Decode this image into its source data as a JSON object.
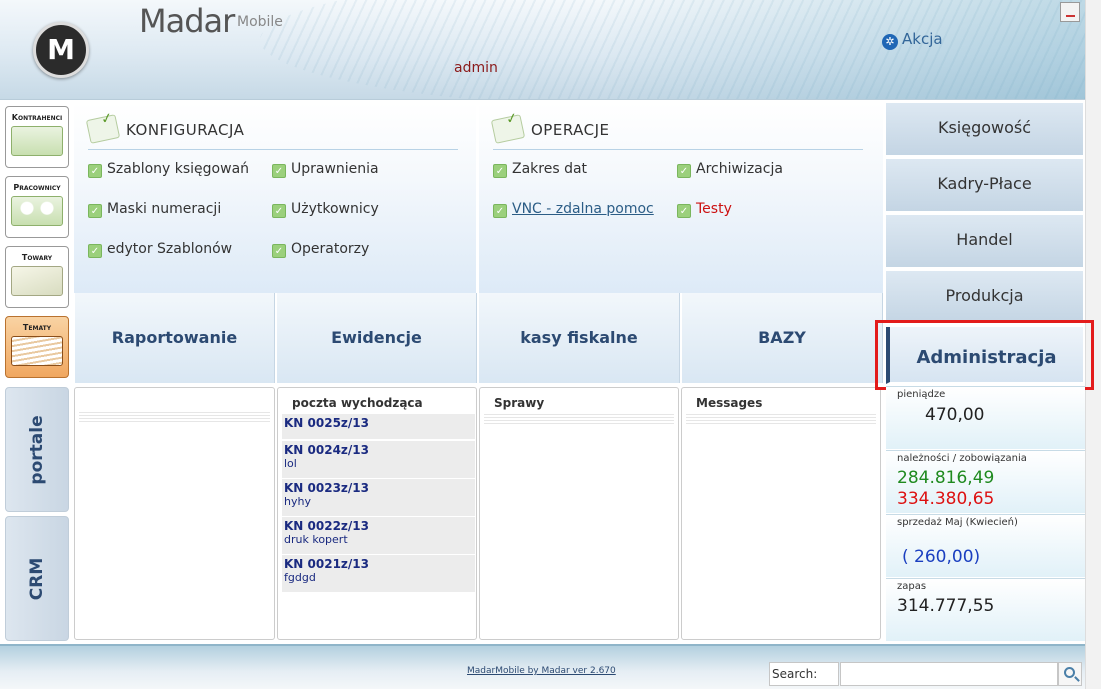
{
  "header": {
    "brand": "Madar",
    "brand_sub": "Mobile",
    "logo_letter": "M",
    "user": "admin",
    "akcja": "Akcja"
  },
  "left_nav": [
    {
      "label": "Kontrahenci",
      "icon": "buildings-icon"
    },
    {
      "label": "Pracownicy",
      "icon": "people-icon"
    },
    {
      "label": "Towary",
      "icon": "box-icon"
    },
    {
      "label": "Tematy",
      "icon": "documents-icon"
    }
  ],
  "vertical_tabs": [
    "portale",
    "CRM"
  ],
  "konfiguracja": {
    "title": "KONFIGURACJA",
    "items": [
      "Szablony księgowań",
      "Uprawnienia",
      "Maski numeracji",
      "Użytkownicy",
      "edytor Szablonów",
      "Operatorzy"
    ]
  },
  "operacje": {
    "title": "OPERACJE",
    "items": [
      "Zakres dat",
      "Archiwizacja",
      "VNC - zdalna pomoc",
      "Testy"
    ]
  },
  "tabs": [
    "Raportowanie",
    "Ewidencje",
    "kasy fiskalne",
    "BAZY"
  ],
  "columns": {
    "c2_title": "poczta wychodząca",
    "c3_title": "Sprawy",
    "c4_title": "Messages",
    "documents": [
      {
        "number": "KN 0025z/13",
        "desc": ""
      },
      {
        "number": "KN 0024z/13",
        "desc": "lol"
      },
      {
        "number": "KN 0023z/13",
        "desc": "hyhy"
      },
      {
        "number": "KN 0022z/13",
        "desc": "druk kopert"
      },
      {
        "number": "KN 0021z/13",
        "desc": "fgdgd"
      }
    ]
  },
  "right_menu": [
    "Księgowość",
    "Kadry-Płace",
    "Handel",
    "Produkcja",
    "Administracja"
  ],
  "stats": {
    "money_label": "pieniądze",
    "money_value": "470,00",
    "receivables_label": "należności / zobowiązania",
    "receivables_value": "284.816,49",
    "payables_value": "334.380,65",
    "sales_label": "sprzedaż Maj (Kwiecień)",
    "sales_value": "( 260,00)",
    "stock_label": "zapas",
    "stock_value": "314.777,55"
  },
  "footer": {
    "version": "MadarMobile by Madar ver 2.670",
    "search_label": "Search:",
    "search_value": ""
  },
  "colors": {
    "accent": "#2c4a72",
    "highlight": "#e31b1b",
    "positive": "#1f8a1f",
    "negative": "#dd1111",
    "sales": "#1a3fc0"
  }
}
